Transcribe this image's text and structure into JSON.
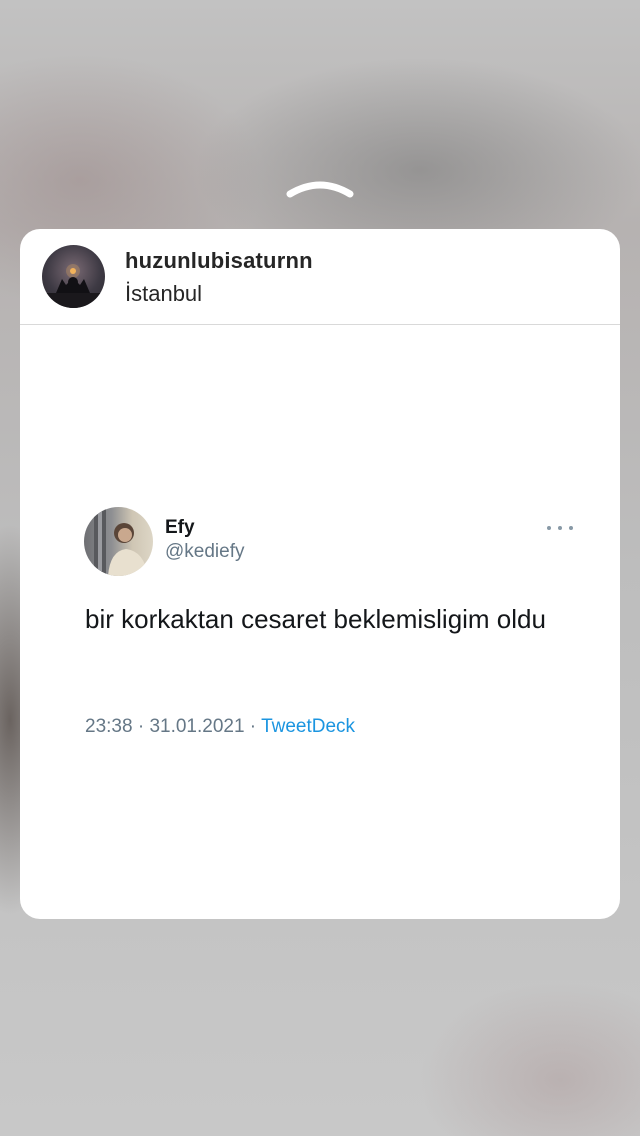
{
  "post": {
    "username": "huzunlubisaturnn",
    "location": "İstanbul",
    "avatar_icon": "profile-photo"
  },
  "tweet": {
    "name": "Efy",
    "handle": "@kediefy",
    "text": "bir korkaktan cesaret beklemisligim oldu",
    "time": "23:38",
    "separator": " · ",
    "date": "31.01.2021",
    "source": "TweetDeck",
    "more_icon": "more-horizontal-icon"
  },
  "colors": {
    "card_background": "#ffffff",
    "handle_gray": "#657786",
    "source_blue": "#1b95e0",
    "text_dark": "#14171a"
  }
}
